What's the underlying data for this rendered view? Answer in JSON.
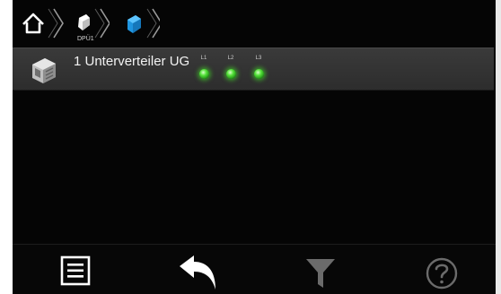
{
  "breadcrumb": {
    "items": [
      {
        "icon": "home-icon"
      },
      {
        "icon": "meter-white-icon",
        "label": "DPÜ1"
      },
      {
        "icon": "meter-blue-icon"
      }
    ]
  },
  "list": {
    "rows": [
      {
        "icon": "distribution-box-icon",
        "label": "1 Unterverteiler UG",
        "phases": [
          {
            "label": "L1",
            "status": "ok"
          },
          {
            "label": "L2",
            "status": "ok"
          },
          {
            "label": "L3",
            "status": "ok"
          }
        ]
      }
    ]
  },
  "toolbar": {
    "buttons": [
      {
        "icon": "list-menu-icon"
      },
      {
        "icon": "back-arrow-icon"
      },
      {
        "icon": "filter-icon"
      },
      {
        "icon": "help-icon"
      }
    ]
  },
  "colors": {
    "background": "#050505",
    "row": "#333333",
    "led_on": "#3fd92a",
    "accent_blue": "#2aa8f0",
    "disabled_icon": "#6b6b6b"
  }
}
